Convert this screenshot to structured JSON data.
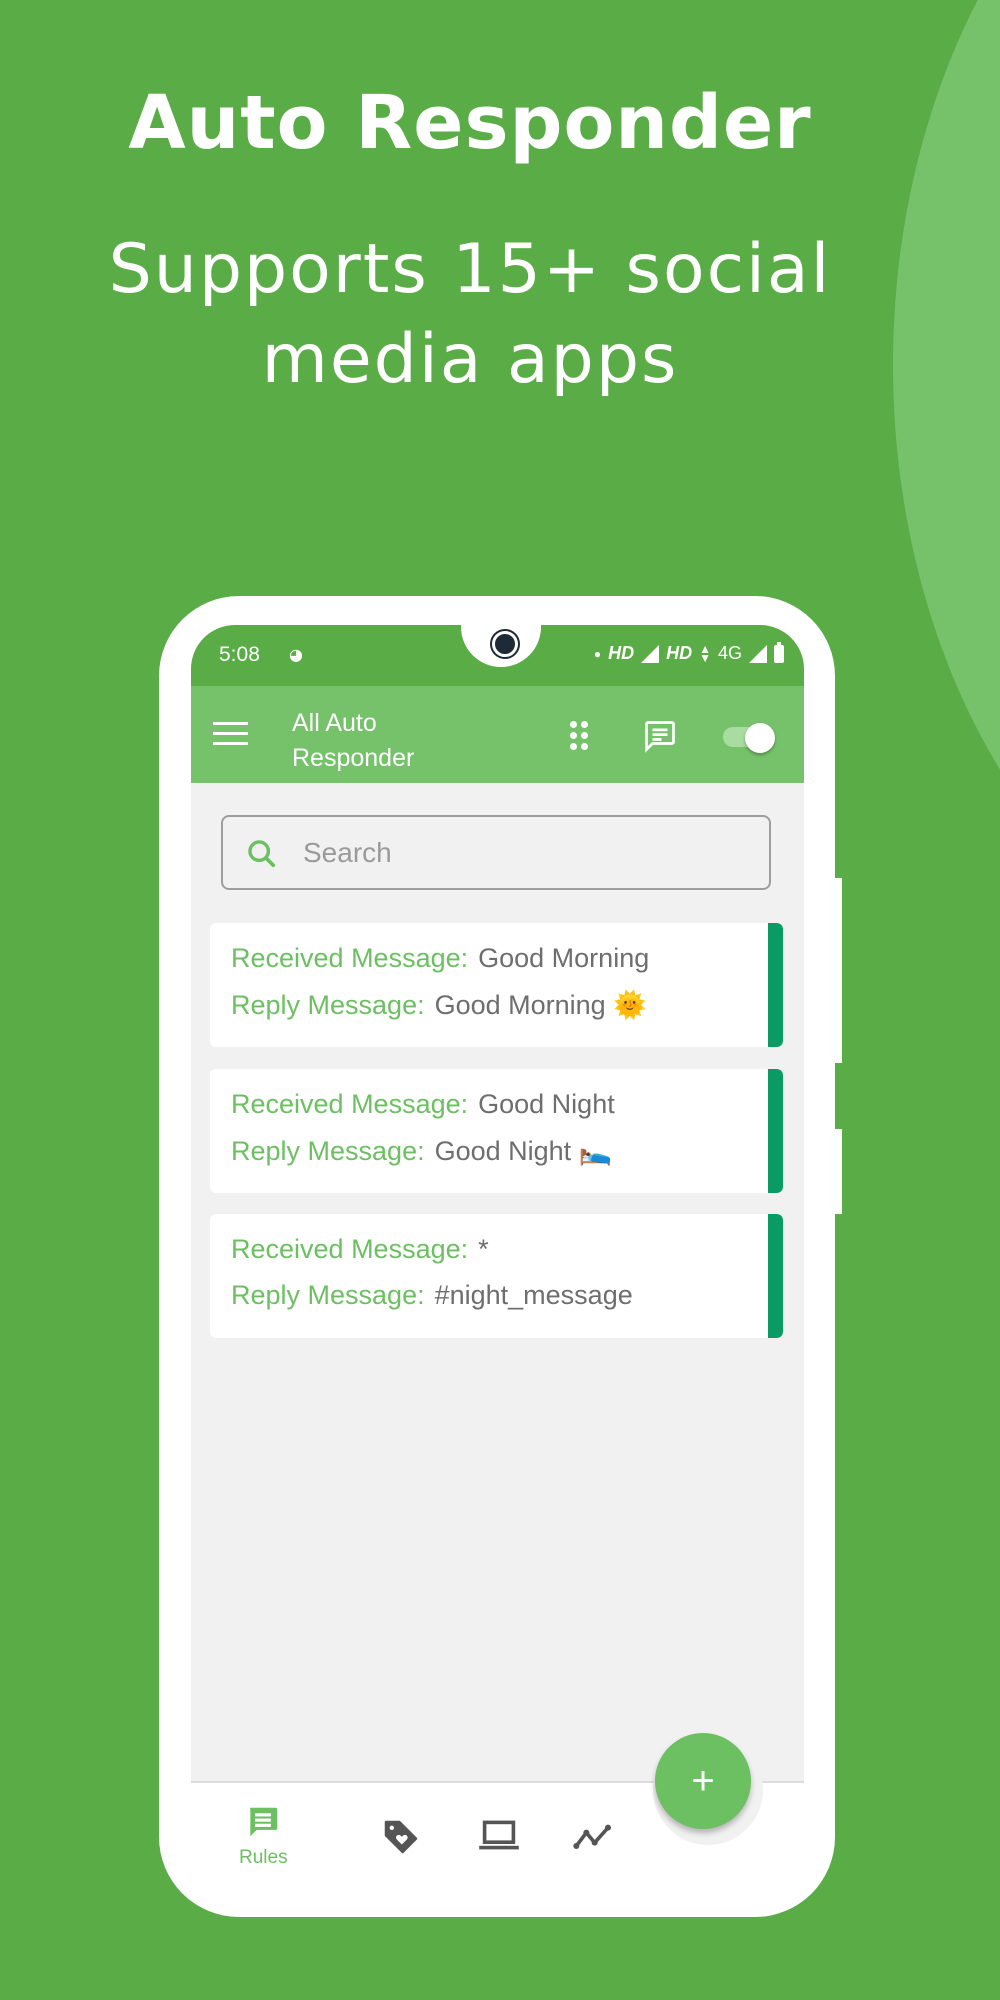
{
  "hero": {
    "title": "Auto Responder",
    "subtitle_line1": "Supports 15+ social",
    "subtitle_line2": "media apps"
  },
  "statusbar": {
    "time": "5:08",
    "network1": "HD",
    "network2": "HD",
    "network_type": "4G",
    "icons": [
      "notification-icon",
      "dot-icon",
      "signal-icon",
      "data-arrows-icon",
      "signal-icon",
      "battery-icon"
    ]
  },
  "appbar": {
    "title_line1": "All Auto",
    "title_line2": "Responder",
    "menu_icon": "hamburger-menu-icon",
    "apps_icon": "apps-grid-icon",
    "message_icon": "chat-message-icon",
    "toggle_on": true
  },
  "search": {
    "placeholder": "Search",
    "value": ""
  },
  "rules": [
    {
      "received_label": "Received Message:",
      "received": "Good Morning",
      "reply_label": "Reply Message:",
      "reply": "Good Morning 🌞"
    },
    {
      "received_label": "Received Message:",
      "received": "Good Night",
      "reply_label": "Reply Message:",
      "reply": "Good Night 🛌"
    },
    {
      "received_label": "Received Message:",
      "received": "*",
      "reply_label": "Reply Message:",
      "reply": "#night_message"
    }
  ],
  "bottomnav": {
    "items": [
      {
        "label": "Rules",
        "icon": "rules-message-icon",
        "active": true
      },
      {
        "label": "",
        "icon": "tag-heart-icon",
        "active": false
      },
      {
        "label": "",
        "icon": "laptop-icon",
        "active": false
      },
      {
        "label": "",
        "icon": "stats-line-icon",
        "active": false
      }
    ],
    "fab_label": "+"
  },
  "colors": {
    "background": "#5aac46",
    "accent": "#76c26a",
    "label_green": "#6cc062",
    "card_bar": "#0a9a63"
  }
}
